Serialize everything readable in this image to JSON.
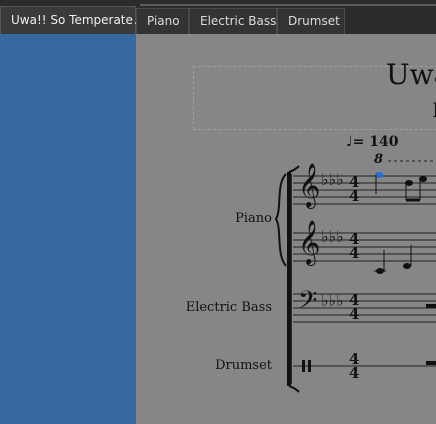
{
  "tabs": [
    {
      "label": "Uwa!! So Temperate♫",
      "active": true
    },
    {
      "label": "Piano",
      "active": false
    },
    {
      "label": "Electric Bass",
      "active": false
    },
    {
      "label": "Drumset",
      "active": false
    }
  ],
  "score": {
    "title": "Uwa",
    "subtitle": "I",
    "tempo": "= 140",
    "ottava": "8",
    "instruments": {
      "piano": "Piano",
      "electric_bass": "Electric Bass",
      "drumset": "Drumset"
    },
    "time_signature": {
      "numerator": "4",
      "denominator": "4"
    }
  },
  "colors": {
    "sidebar": "#3868a0",
    "canvas": "#868686",
    "selection": "#1f6fd6"
  }
}
